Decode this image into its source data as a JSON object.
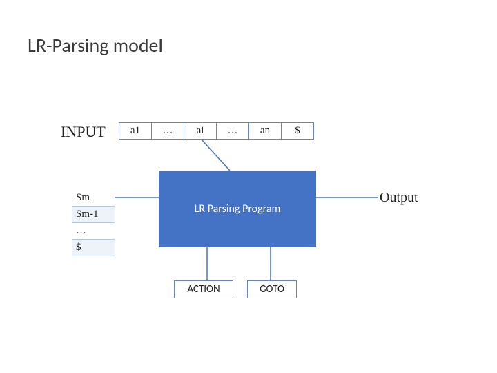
{
  "title": "LR-Parsing model",
  "input_label": "INPUT",
  "input_cells": [
    "a1",
    "…",
    "ai",
    "…",
    "an",
    "$"
  ],
  "stack_cells": [
    "Sm",
    "Sm-1",
    "…",
    "$"
  ],
  "program_label": "LR Parsing Program",
  "output_label": "Output",
  "action_label": "ACTION",
  "goto_label": "GOTO",
  "colors": {
    "box_fill": "#4472c4",
    "box_border": "#6a86b8"
  }
}
